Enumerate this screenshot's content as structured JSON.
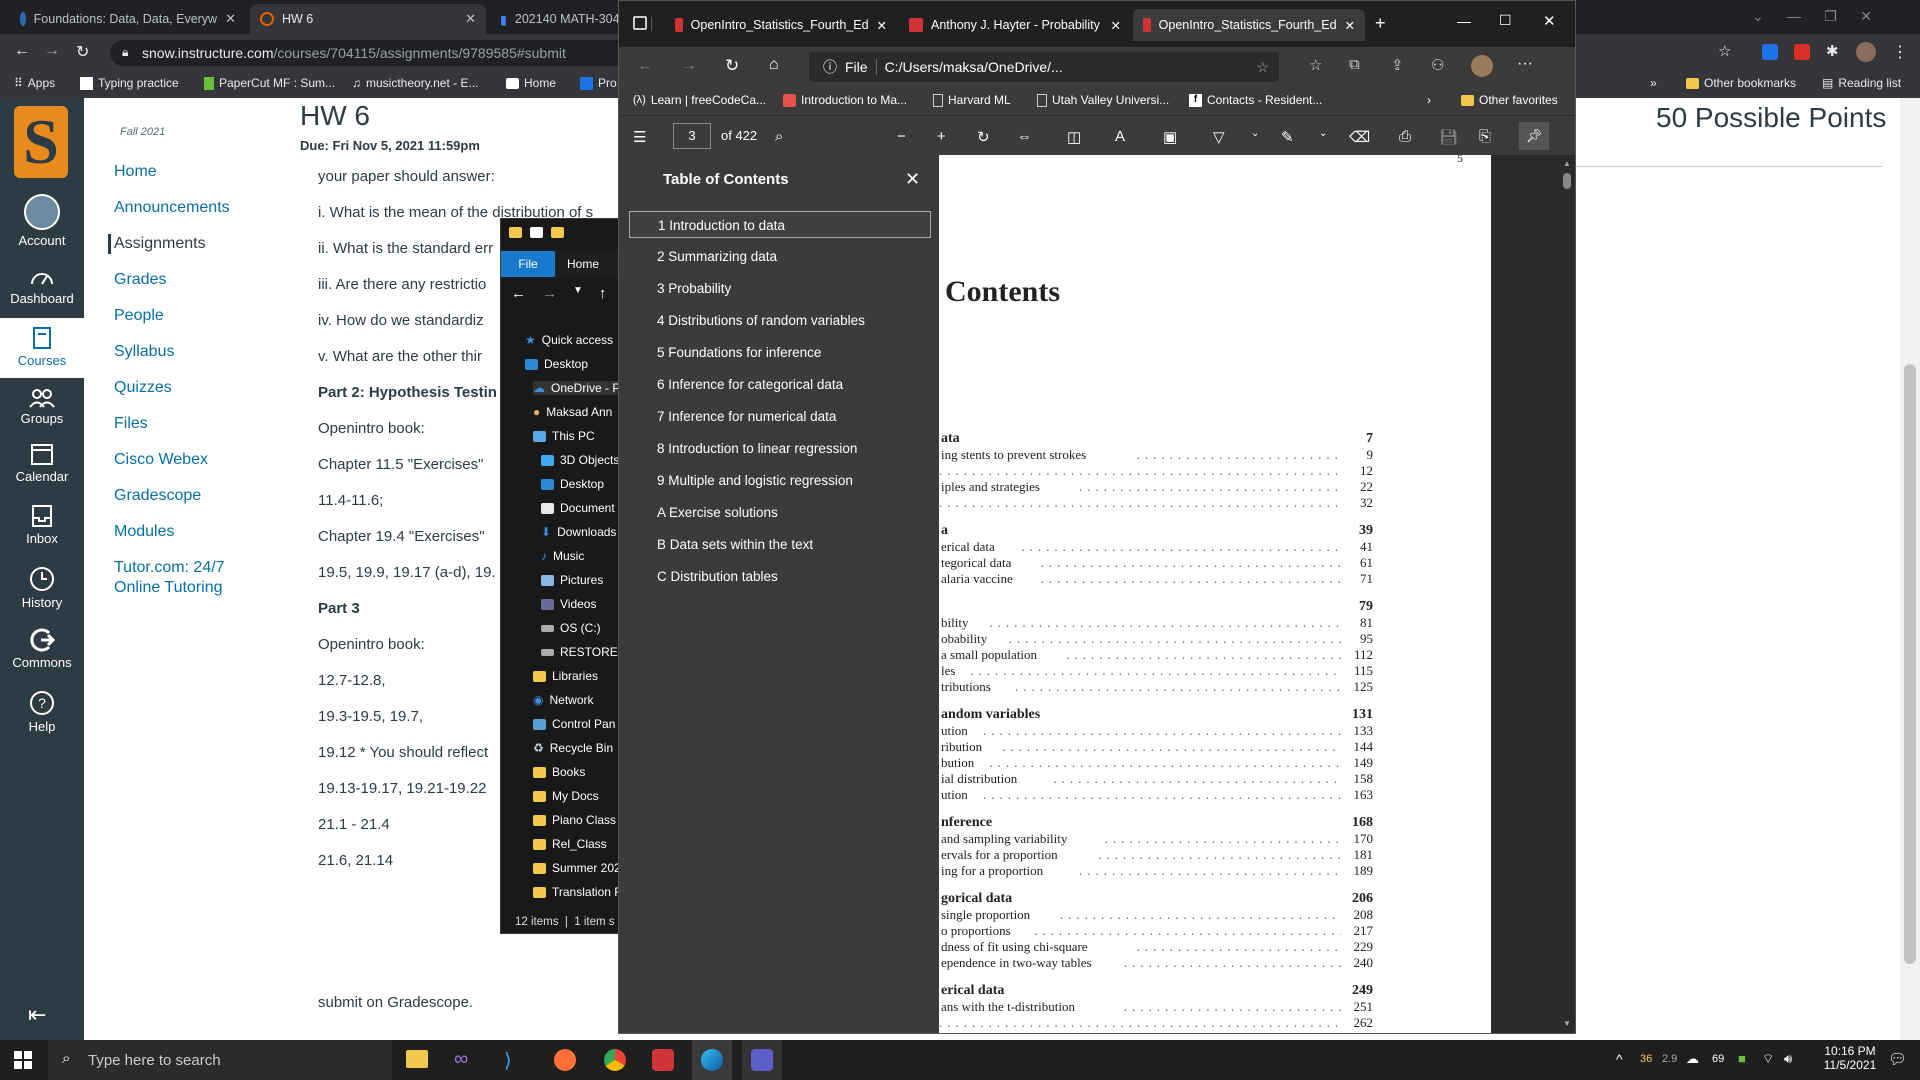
{
  "chrome": {
    "tabs": [
      {
        "title": "Foundations: Data, Data, Everyw",
        "favcolor": "#2b6cb0"
      },
      {
        "title": "HW 6",
        "favcolor": "#e66000"
      },
      {
        "title": "202140 MATH-304",
        "favcolor": "#3b82f6"
      }
    ],
    "url_host": "snow.instructure.com",
    "url_path": "/courses/704115/assignments/9789585#submit",
    "bookmarks": [
      "Apps",
      "Typing practice",
      "PaperCut MF : Sum...",
      "musictheory.net - E...",
      "Home",
      "Pro"
    ],
    "bookmarks_right": [
      "Other bookmarks",
      "Reading list"
    ]
  },
  "canvas": {
    "logo_letter": "S",
    "global_nav": [
      "Account",
      "Dashboard",
      "Courses",
      "Groups",
      "Calendar",
      "Inbox",
      "History",
      "Commons",
      "Help"
    ],
    "term": "Fall 2021",
    "course_nav": [
      "Home",
      "Announcements",
      "Assignments",
      "Grades",
      "People",
      "Syllabus",
      "Quizzes",
      "Files",
      "Cisco Webex",
      "Gradescope",
      "Modules",
      "Tutor.com: 24/7",
      "Online Tutoring"
    ],
    "title": "HW 6",
    "due": "Due: Fri Nov 5, 2021 11:59pm",
    "points": "50 Possible Points",
    "content": [
      "your paper should answer:",
      "i.  What is the mean of the distribution of s",
      "ii. What is the standard err",
      "iii.  Are there any restrictio",
      "iv.  How do we standardiz",
      "v.  What are the other thir",
      "Part 2:  Hypothesis Testin",
      "Openintro book:",
      "Chapter 11.5 \"Exercises\"",
      "11.4-11.6;",
      "Chapter 19.4 \"Exercises\"",
      "19.5, 19.9, 19.17 (a-d), 19.",
      "Part 3",
      "Openintro book:",
      "12.7-12.8,",
      "19.3-19.5, 19.7,",
      "19.12 * You should reflect",
      "19.13-19.17, 19.21-19.22",
      "21.1 - 21.4",
      "21.6, 21.14",
      "submit on Gradescope."
    ]
  },
  "explorer": {
    "ribbon": [
      "File",
      "Home"
    ],
    "tree": [
      "Quick access",
      "Desktop",
      "OneDrive - P",
      "Maksad Ann",
      "This PC",
      "3D Objects",
      "Desktop",
      "Document",
      "Downloads",
      "Music",
      "Pictures",
      "Videos",
      "OS (C:)",
      "RESTORE (I",
      "Libraries",
      "Network",
      "Control Pan",
      "Recycle Bin",
      "Books",
      "My Docs",
      "Piano Class",
      "Rel_Class",
      "Summer 202",
      "Translation F"
    ],
    "status": [
      "12 items",
      "1 item s"
    ]
  },
  "edge": {
    "tabs": [
      "OpenIntro_Statistics_Fourth_Ed",
      "Anthony J. Hayter - Probability",
      "OpenIntro_Statistics_Fourth_Ed"
    ],
    "file_label": "File",
    "path": "C:/Users/maksa/OneDrive/...",
    "favorites": [
      "Learn | freeCodeCa...",
      "Introduction to Ma...",
      "Harvard ML",
      "Utah Valley Universi...",
      "Contacts - Resident..."
    ],
    "other_favorites": "Other favorites",
    "page_num": "3",
    "page_total": "of 422",
    "toc_title": "Table of Contents",
    "toc": [
      "1 Introduction to data",
      "2 Summarizing data",
      "3 Probability",
      "4 Distributions of random variables",
      "5 Foundations for inference",
      "6 Inference for categorical data",
      "7 Inference for numerical data",
      "8 Introduction to linear regression",
      "9 Multiple and logistic regression",
      "A Exercise solutions",
      "B Data sets within the text",
      "C Distribution tables"
    ],
    "doc_heading": "Contents",
    "doc_corner": "5",
    "doc_rows": [
      {
        "t": "ata",
        "p": "7",
        "b": true
      },
      {
        "t": "ing stents to prevent strokes",
        "p": "9"
      },
      {
        "t": "",
        "p": "12"
      },
      {
        "t": "iples and strategies",
        "p": "22"
      },
      {
        "t": "",
        "p": "32"
      },
      {
        "t": "a",
        "p": "39",
        "b": true
      },
      {
        "t": "erical data",
        "p": "41"
      },
      {
        "t": "tegorical data",
        "p": "61"
      },
      {
        "t": "alaria vaccine",
        "p": "71"
      },
      {
        "t": "",
        "p": "79",
        "b": true
      },
      {
        "t": "bility",
        "p": "81"
      },
      {
        "t": "obability",
        "p": "95"
      },
      {
        "t": "a small population",
        "p": "112"
      },
      {
        "t": "les",
        "p": "115"
      },
      {
        "t": "tributions",
        "p": "125"
      },
      {
        "t": "andom variables",
        "p": "131",
        "b": true
      },
      {
        "t": "ution",
        "p": "133"
      },
      {
        "t": "ribution",
        "p": "144"
      },
      {
        "t": "bution",
        "p": "149"
      },
      {
        "t": "ial distribution",
        "p": "158"
      },
      {
        "t": "ution",
        "p": "163"
      },
      {
        "t": "nference",
        "p": "168",
        "b": true
      },
      {
        "t": "and sampling variability",
        "p": "170"
      },
      {
        "t": "ervals for a proportion",
        "p": "181"
      },
      {
        "t": "ing for a proportion",
        "p": "189"
      },
      {
        "t": "gorical data",
        "p": "206",
        "b": true
      },
      {
        "t": "single proportion",
        "p": "208"
      },
      {
        "t": "o proportions",
        "p": "217"
      },
      {
        "t": "dness of fit using chi-square",
        "p": "229"
      },
      {
        "t": "ependence in two-way tables",
        "p": "240"
      },
      {
        "t": "erical data",
        "p": "249",
        "b": true
      },
      {
        "t": "ans with the t-distribution",
        "p": "251"
      },
      {
        "t": "",
        "p": "262"
      }
    ]
  },
  "taskbar": {
    "search_placeholder": "Type here to search",
    "weather_a": "36",
    "weather_b": "2.9",
    "weather_c": "69",
    "time": "10:16 PM",
    "date": "11/5/2021"
  }
}
